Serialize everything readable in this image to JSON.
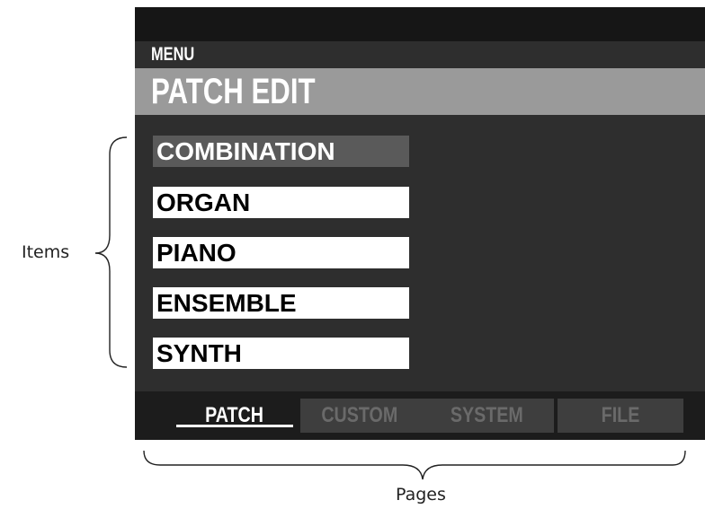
{
  "screen": {
    "menu_label": "MENU",
    "title": "PATCH EDIT",
    "items": [
      {
        "label": "COMBINATION",
        "selected": true
      },
      {
        "label": "ORGAN",
        "selected": false
      },
      {
        "label": "PIANO",
        "selected": false
      },
      {
        "label": "ENSEMBLE",
        "selected": false
      },
      {
        "label": "SYNTH",
        "selected": false
      }
    ],
    "tabs": [
      {
        "label": "PATCH",
        "active": true
      },
      {
        "label": "CUSTOM",
        "active": false
      },
      {
        "label": "SYSTEM",
        "active": false
      },
      {
        "label": "FILE",
        "active": false
      }
    ]
  },
  "annotations": {
    "items_label": "Items",
    "pages_label": "Pages"
  },
  "colors": {
    "screen_bg": "#2e2e2e",
    "title_bar": "#9a9a9a",
    "selected_item": "#5a5a5a",
    "tab_inactive": "#3e3e3e"
  }
}
